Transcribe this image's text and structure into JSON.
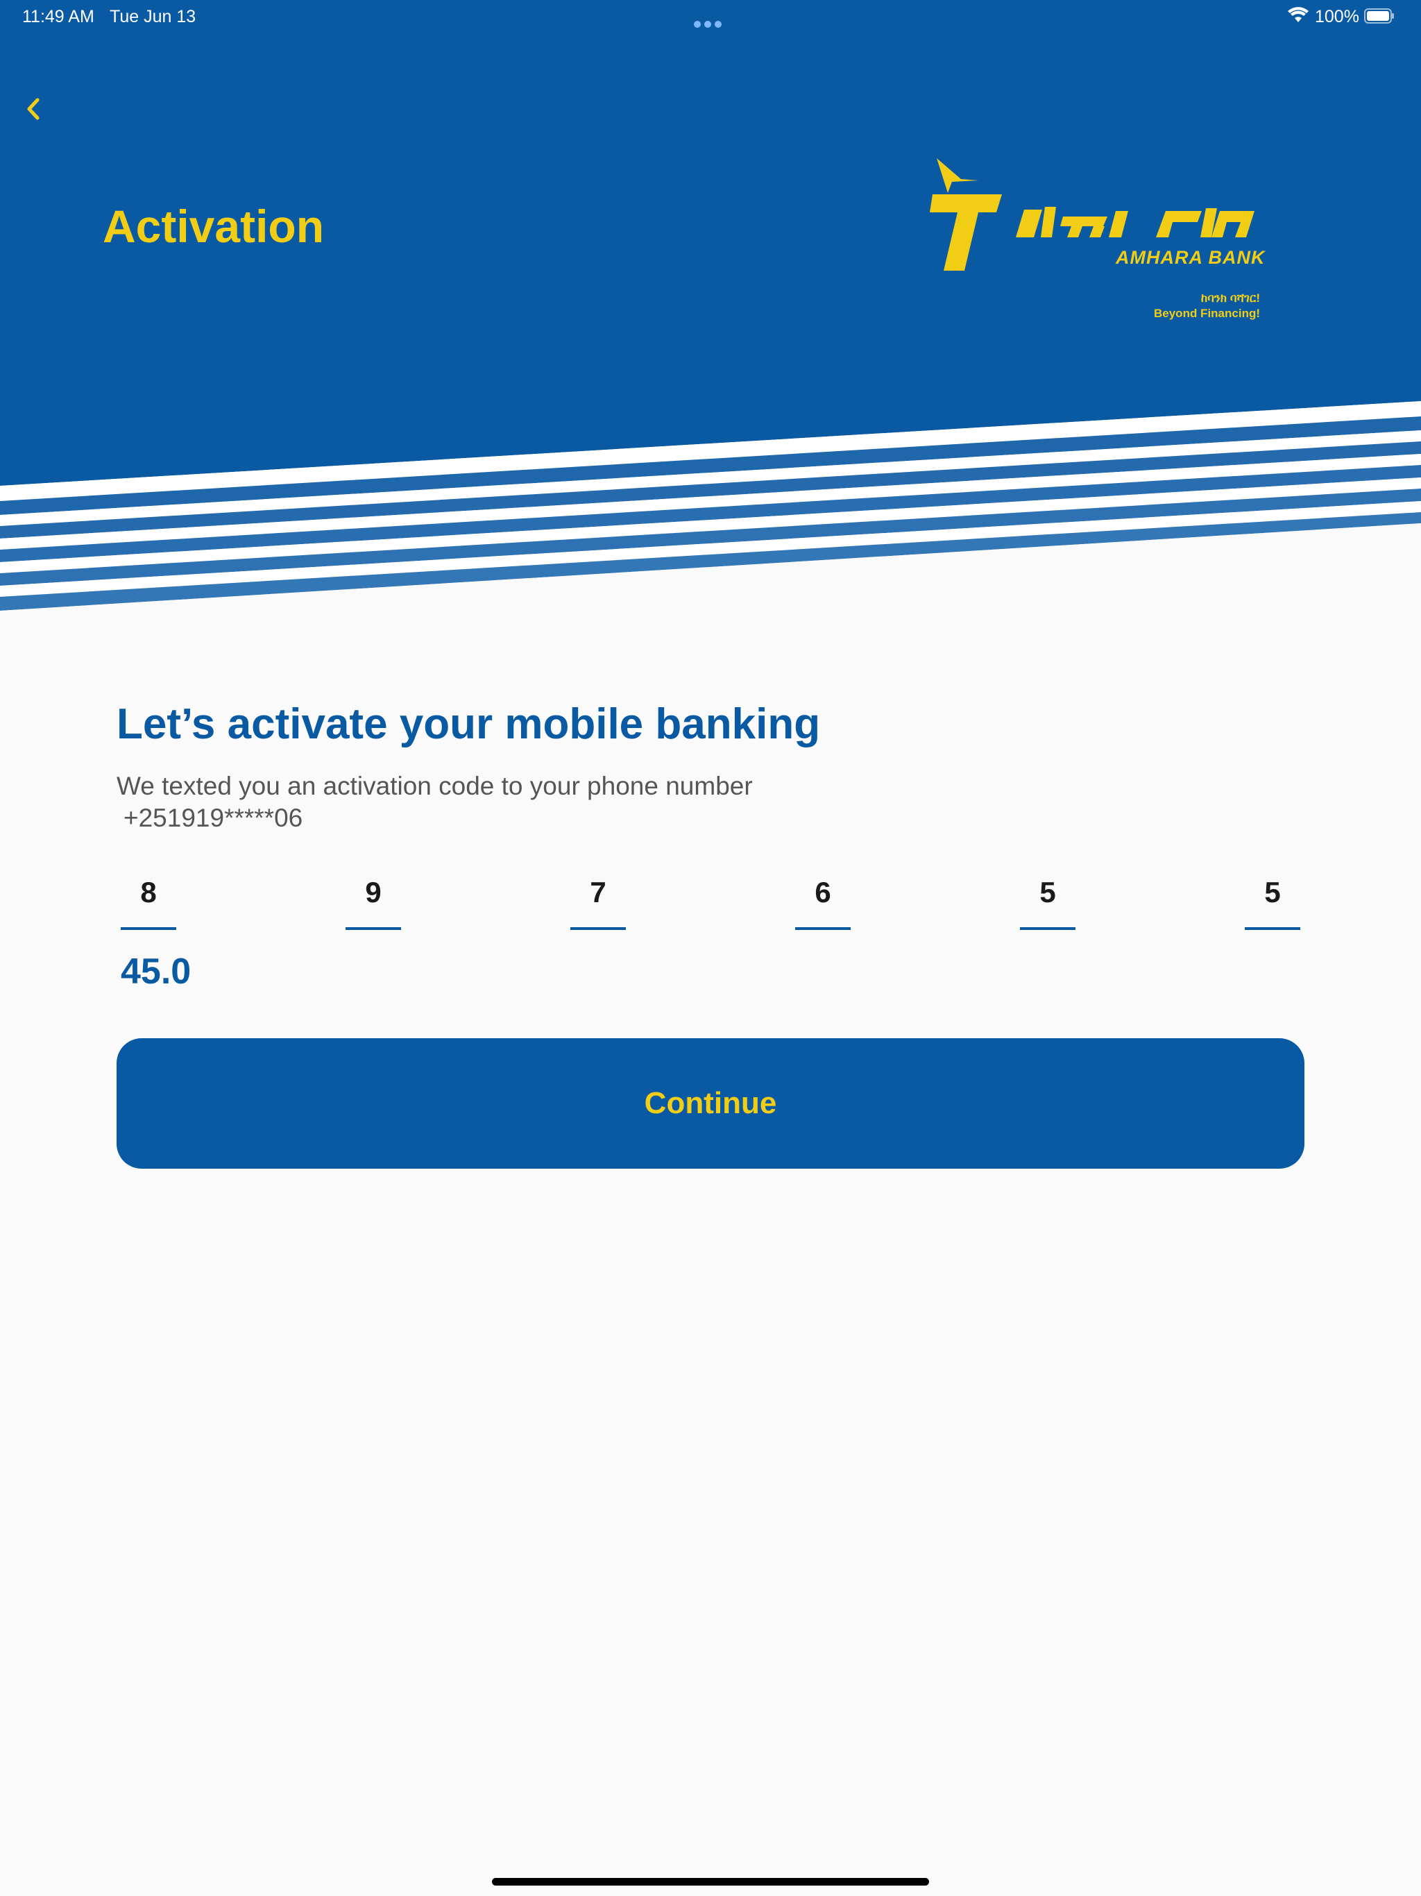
{
  "status_bar": {
    "time": "11:49 AM",
    "date": "Tue Jun 13",
    "battery": "100%",
    "icons": [
      "more-dots-icon",
      "wifi-icon",
      "battery-icon"
    ]
  },
  "header": {
    "title": "Activation",
    "back_icon": "chevron-left-icon",
    "logo": {
      "name_latin": "AMHARA BANK",
      "tagline_am": "ከባንክ ባሻገር!",
      "tagline_en": "Beyond Financing!"
    }
  },
  "main": {
    "heading": "Let’s activate your mobile banking",
    "subtext": "We texted you an activation code to your phone number",
    "phone": "+251919*****06",
    "code_digits": [
      "8",
      "9",
      "7",
      "6",
      "5",
      "5"
    ],
    "timer": "45.0",
    "continue_label": "Continue"
  },
  "colors": {
    "primary_blue": "#0a5aa3",
    "accent_yellow": "#f2cd16",
    "background": "#fafafa"
  }
}
